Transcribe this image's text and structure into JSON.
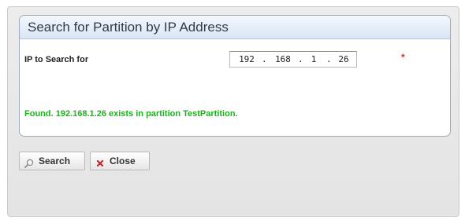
{
  "dialog": {
    "title": "Search for Partition by IP Address",
    "field_label": "IP to Search for",
    "ip_octets": [
      "192",
      "168",
      "1",
      "26"
    ],
    "required_marker": "*",
    "result_message": "Found. 192.168.1.26 exists in partition TestPartition.",
    "result_color": "#17b517"
  },
  "buttons": {
    "search_label": "Search",
    "search_icon": "magnifier-icon",
    "close_label": "Close",
    "close_icon": "red-x-icon"
  }
}
